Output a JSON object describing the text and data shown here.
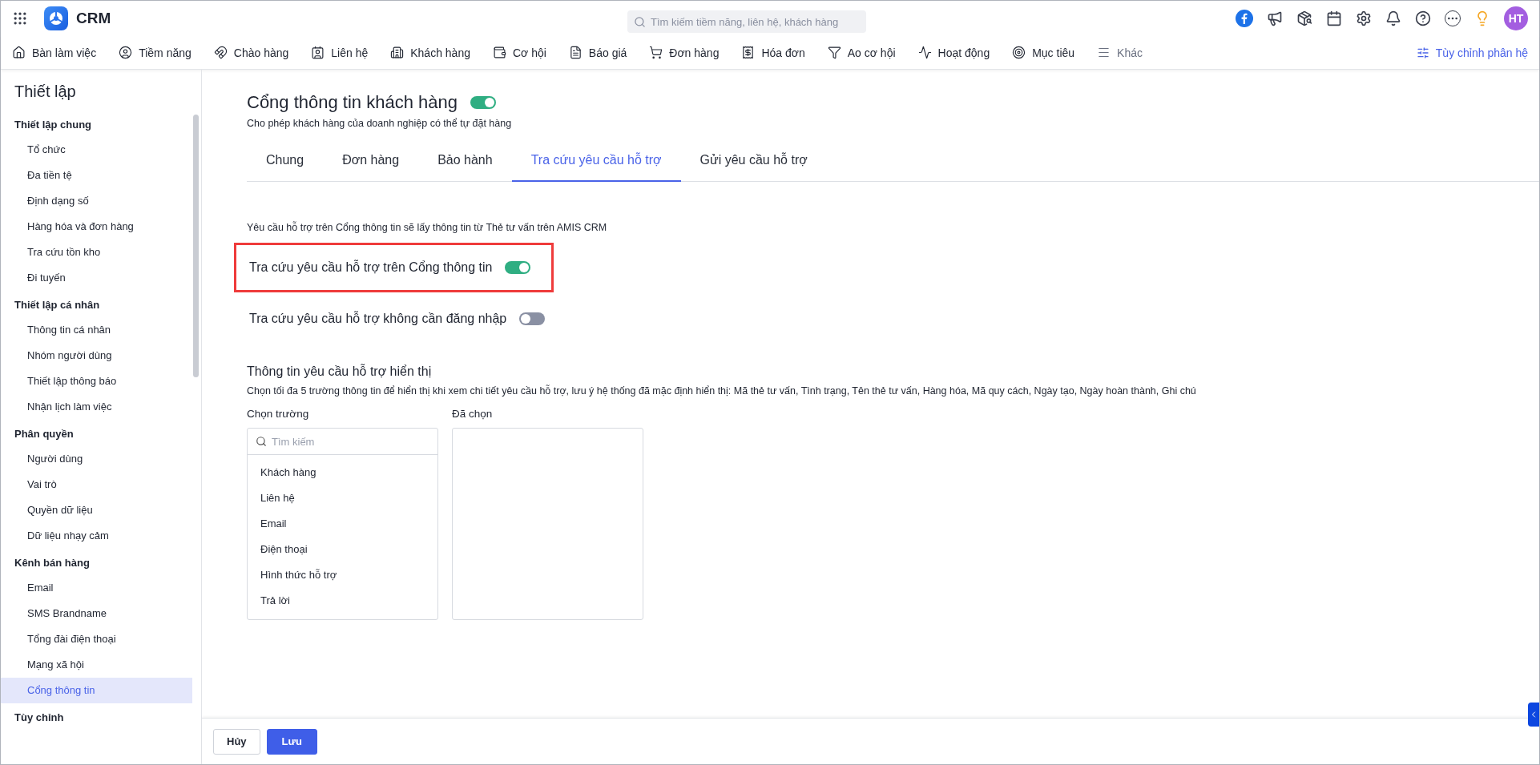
{
  "app": {
    "name": "CRM",
    "search_placeholder": "Tìm kiếm tiềm năng, liên hệ, khách hàng",
    "avatar": "HT"
  },
  "nav": [
    "Bàn làm việc",
    "Tiềm năng",
    "Chào hàng",
    "Liên hệ",
    "Khách hàng",
    "Cơ hội",
    "Báo giá",
    "Đơn hàng",
    "Hóa đơn",
    "Ao cơ hội",
    "Hoạt động",
    "Mục tiêu",
    "Khác"
  ],
  "customize_link": "Tùy chỉnh phân hệ",
  "sidebar": {
    "title": "Thiết lập",
    "groups": [
      {
        "label": "Thiết lập chung",
        "items": [
          {
            "label": "Tổ chức",
            "selected": false
          },
          {
            "label": "Đa tiền tệ",
            "selected": false
          },
          {
            "label": "Định dạng số",
            "selected": false
          },
          {
            "label": "Hàng hóa và đơn hàng",
            "selected": false
          },
          {
            "label": "Tra cứu tồn kho",
            "selected": false
          },
          {
            "label": "Đi tuyến",
            "selected": false
          }
        ]
      },
      {
        "label": "Thiết lập cá nhân",
        "items": [
          {
            "label": "Thông tin cá nhân",
            "selected": false
          },
          {
            "label": "Nhóm người dùng",
            "selected": false
          },
          {
            "label": "Thiết lập thông báo",
            "selected": false
          },
          {
            "label": "Nhận lịch làm việc",
            "selected": false
          }
        ]
      },
      {
        "label": "Phân quyền",
        "items": [
          {
            "label": "Người dùng",
            "selected": false
          },
          {
            "label": "Vai trò",
            "selected": false
          },
          {
            "label": "Quyền dữ liệu",
            "selected": false
          },
          {
            "label": "Dữ liệu nhạy cảm",
            "selected": false
          }
        ]
      },
      {
        "label": "Kênh bán hàng",
        "items": [
          {
            "label": "Email",
            "selected": false
          },
          {
            "label": "SMS Brandname",
            "selected": false
          },
          {
            "label": "Tổng đài điện thoại",
            "selected": false
          },
          {
            "label": "Mạng xã hội",
            "selected": false
          },
          {
            "label": "Cổng thông tin",
            "selected": true
          }
        ]
      },
      {
        "label": "Tùy chỉnh"
      }
    ]
  },
  "page": {
    "title": "Cổng thông tin khách hàng",
    "enabled": true,
    "subtitle": "Cho phép khách hàng của doanh nghiệp có thể tự đặt hàng"
  },
  "tabs": [
    {
      "label": "Chung",
      "selected": false
    },
    {
      "label": "Đơn hàng",
      "selected": false
    },
    {
      "label": "Bảo hành",
      "selected": false
    },
    {
      "label": "Tra cứu yêu cầu hỗ trợ",
      "selected": true
    },
    {
      "label": "Gửi yêu cầu hỗ trợ",
      "selected": false
    }
  ],
  "note": "Yêu cầu hỗ trợ trên Cổng thông tin sẽ lấy thông tin từ Thẻ tư vấn trên AMIS CRM",
  "settings": [
    {
      "label": "Tra cứu yêu cầu hỗ trợ trên Cổng thông tin",
      "on": true,
      "highlighted": true
    },
    {
      "label": "Tra cứu yêu cầu hỗ trợ không cần đăng nhập",
      "on": false,
      "highlighted": false
    }
  ],
  "display_fields": {
    "title": "Thông tin yêu cầu hỗ trợ hiển thị",
    "description": "Chọn tối đa 5 trường thông tin để hiển thị khi xem chi tiết yêu cầu hỗ trợ, lưu ý hệ thống đã mặc định hiển thị: Mã thẻ tư vấn, Tình trạng, Tên thẻ tư vấn, Hàng hóa, Mã quy cách, Ngày tạo, Ngày hoàn thành, Ghi chú",
    "available_label": "Chọn trường",
    "search_placeholder": "Tìm kiếm",
    "available": [
      "Khách hàng",
      "Liên hệ",
      "Email",
      "Điện thoại",
      "Hình thức hỗ trợ",
      "Trả lời"
    ],
    "selected_label": "Đã chọn"
  },
  "footer": {
    "buttons": [
      {
        "label": "Hủy",
        "kind": "secondary"
      },
      {
        "label": "Lưu",
        "kind": "primary"
      }
    ]
  }
}
